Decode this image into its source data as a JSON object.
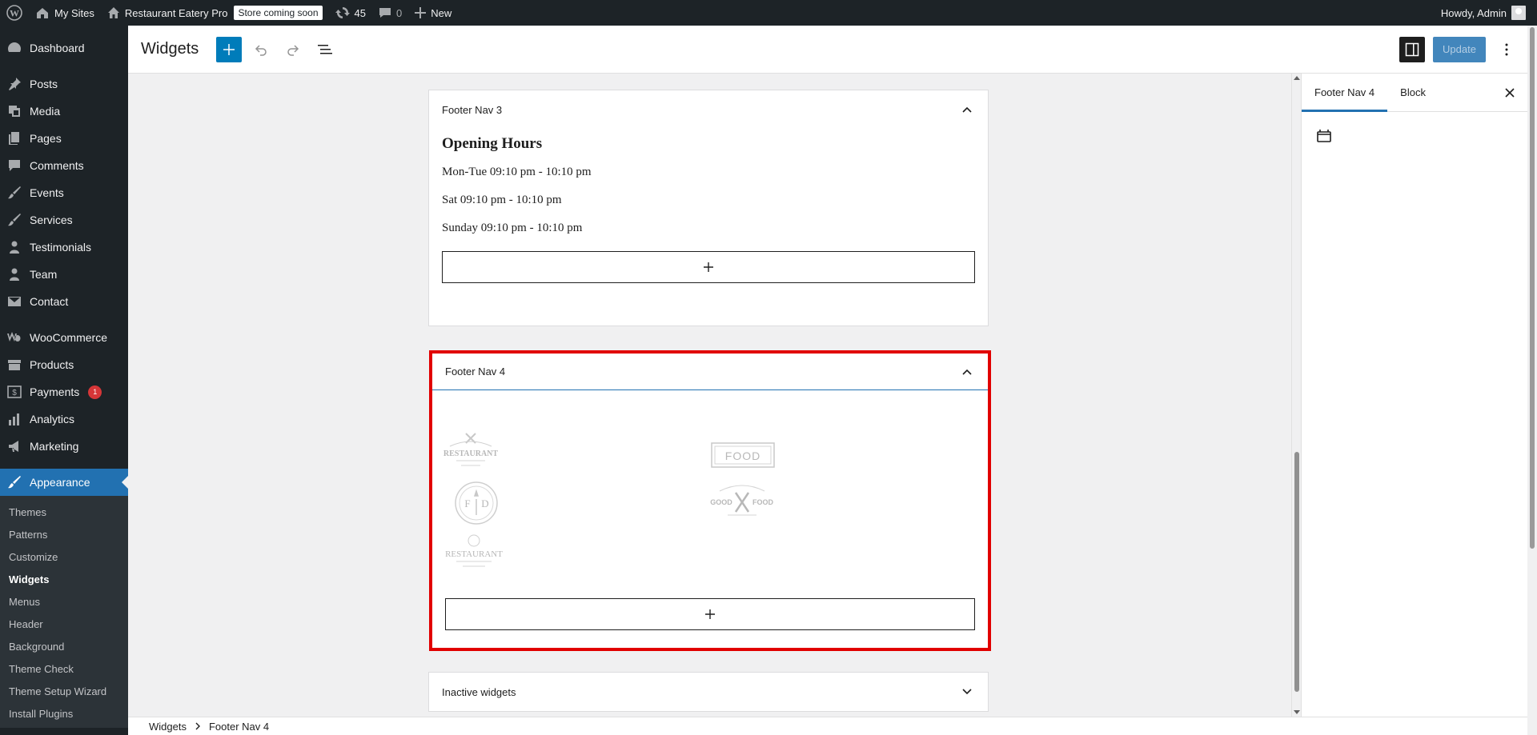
{
  "admin_bar": {
    "my_sites": "My Sites",
    "site_name": "Restaurant Eatery Pro",
    "store_badge": "Store coming soon",
    "updates_count": "45",
    "comments_count": "0",
    "new_label": "New",
    "howdy": "Howdy, Admin"
  },
  "sidebar": {
    "items": [
      {
        "label": "Dashboard",
        "icon": "dashboard-icon"
      },
      {
        "label": "Posts",
        "icon": "pin-icon"
      },
      {
        "label": "Media",
        "icon": "media-icon"
      },
      {
        "label": "Pages",
        "icon": "pages-icon"
      },
      {
        "label": "Comments",
        "icon": "comment-icon"
      },
      {
        "label": "Events",
        "icon": "brush-icon"
      },
      {
        "label": "Services",
        "icon": "brush-icon"
      },
      {
        "label": "Testimonials",
        "icon": "person-icon"
      },
      {
        "label": "Team",
        "icon": "person-icon"
      },
      {
        "label": "Contact",
        "icon": "mail-icon"
      },
      {
        "label": "WooCommerce",
        "icon": "woo-icon"
      },
      {
        "label": "Products",
        "icon": "archive-icon"
      },
      {
        "label": "Payments",
        "icon": "dollar-icon",
        "badge": "1"
      },
      {
        "label": "Analytics",
        "icon": "bar-chart-icon"
      },
      {
        "label": "Marketing",
        "icon": "megaphone-icon"
      },
      {
        "label": "Appearance",
        "icon": "brush-icon"
      }
    ],
    "submenu": [
      "Themes",
      "Patterns",
      "Customize",
      "Widgets",
      "Menus",
      "Header",
      "Background",
      "Theme Check",
      "Theme Setup Wizard",
      "Install Plugins"
    ]
  },
  "header": {
    "title": "Widgets",
    "update_label": "Update"
  },
  "footer_nav_3": {
    "title": "Footer Nav 3",
    "heading": "Opening Hours",
    "lines": [
      "Mon-Tue 09:10 pm - 10:10 pm",
      "Sat 09:10 pm - 10:10 pm",
      "Sunday 09:10 pm - 10:10 pm"
    ]
  },
  "footer_nav_4": {
    "title": "Footer Nav 4",
    "logos": {
      "restaurant_1": "RESTAURANT",
      "food": "FOOD",
      "fd_left": "F",
      "fd_right": "D",
      "good": "GOOD",
      "food_2": "FOOD",
      "restaurant_2": "RESTAURANT"
    }
  },
  "inactive": {
    "title": "Inactive widgets"
  },
  "panel": {
    "tab_area": "Footer Nav 4",
    "tab_block": "Block"
  },
  "breadcrumb": {
    "root": "Widgets",
    "current": "Footer Nav 4"
  },
  "colors": {
    "accent": "#2271b1",
    "selection_border": "#e10000",
    "admin_dark": "#1d2327"
  }
}
